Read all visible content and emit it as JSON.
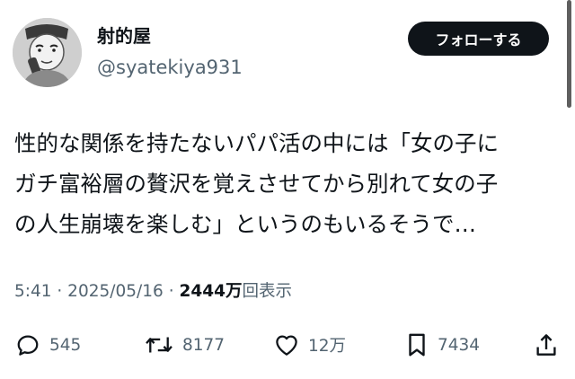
{
  "author": {
    "display_name": "射的屋",
    "handle": "@syatekiya931"
  },
  "follow_button": {
    "label": "フォローする"
  },
  "tweet": {
    "lines": [
      "性的な関係を持たないパパ活の中には「女の子に",
      "ガチ富裕層の贅沢を覚えさせてから別れて女の子",
      "の人生崩壊を楽しむ」というのもいるそうで…"
    ]
  },
  "meta": {
    "time": "5:41 · 2025/05/16 · ",
    "views_count": "2444万",
    "views_label": "回表示"
  },
  "actions": {
    "reply": {
      "icon": "reply-icon",
      "count": "545"
    },
    "retweet": {
      "icon": "retweet-icon",
      "count": "8177"
    },
    "like": {
      "icon": "heart-icon",
      "count": "12万"
    },
    "bookmark": {
      "icon": "bookmark-icon",
      "count": "7434"
    },
    "share": {
      "icon": "share-icon"
    }
  }
}
